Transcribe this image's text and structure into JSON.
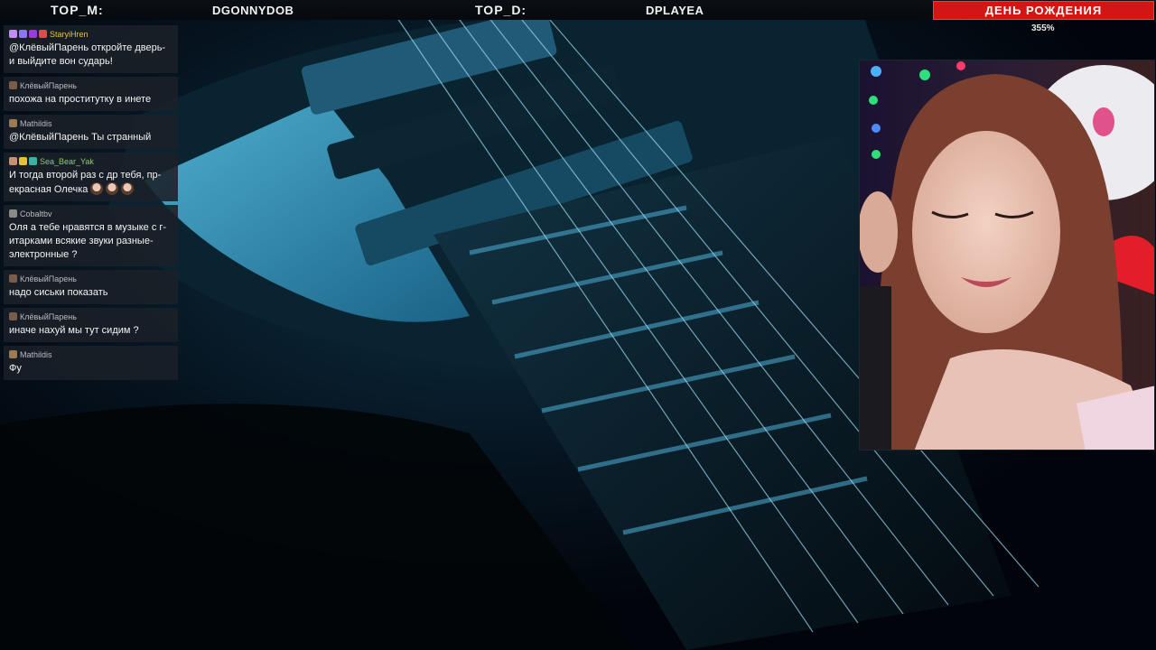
{
  "topbar": {
    "top_m_label": "TOP_M:",
    "top_m_name": "DGONNYDOB",
    "top_d_label": "TOP_D:",
    "top_d_name": "DPLAYEA",
    "goal_label": "ДЕНЬ РОЖДЕНИЯ",
    "goal_percent": "355%"
  },
  "chat": {
    "messages": [
      {
        "user": "StaryiHren",
        "user_color": "gold",
        "badges": [
          "#c48cf0",
          "#8d74ff",
          "#9a3be0",
          "#e24a4a"
        ],
        "text": "@КлёвыйПарень откройте дверь- и выйдите вон сударь!"
      },
      {
        "user": "КлёвыйПарень",
        "user_color": "grey",
        "badges": [
          "#7a5c4a"
        ],
        "text": "похожа на проститутку в инете"
      },
      {
        "user": "Mathildis",
        "user_color": "grey",
        "badges": [
          "#9c7a52"
        ],
        "text": "@КлёвыйПарень Ты странный"
      },
      {
        "user": "Sea_Bear_Yak",
        "user_color": "green",
        "badges": [
          "#c89070",
          "#e8c030",
          "#3fb0a0"
        ],
        "text": "И тогда второй раз с др тебя, пр- екрасная Олечка",
        "emotes": 3
      },
      {
        "user": "Cobaltbv",
        "user_color": "grey",
        "badges": [
          "#8a8a8a"
        ],
        "text": "Оля а тебе нравятся в музыке с г- итарками всякие звуки разные- электронные ?"
      },
      {
        "user": "КлёвыйПарень",
        "user_color": "grey",
        "badges": [
          "#7a5c4a"
        ],
        "text": "надо сиськи показать"
      },
      {
        "user": "КлёвыйПарень",
        "user_color": "grey",
        "badges": [
          "#7a5c4a"
        ],
        "text": "иначе нахуй мы тут сидим ?"
      },
      {
        "user": "Mathildis",
        "user_color": "grey",
        "badges": [
          "#9c7a52"
        ],
        "text": "Фу"
      }
    ]
  },
  "icons": {
    "webcam": "streamer-webcam-feed",
    "background": "electric-guitar-background"
  },
  "colors": {
    "goal_bg": "#d41515",
    "accent_blue": "#2f9ed0"
  }
}
